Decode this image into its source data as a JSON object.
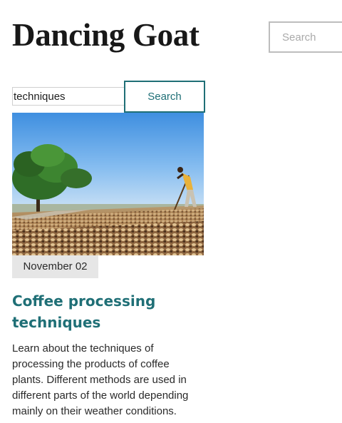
{
  "header": {
    "site_title": "Dancing Goat",
    "search_placeholder": "Search"
  },
  "search": {
    "query": "techniques",
    "button_label": "Search"
  },
  "results": [
    {
      "date": "November 02",
      "title": "Coffee processing techniques",
      "summary": "Learn about the techniques of processing the products of coffee plants. Different methods are used in different parts of the world depending mainly on their weather conditions.",
      "image_icon": "coffee-drying-photo"
    }
  ],
  "colors": {
    "accent": "#1f6f76",
    "badge_bg": "#e6e6e6",
    "header_search_border": "#bdbdbd"
  }
}
